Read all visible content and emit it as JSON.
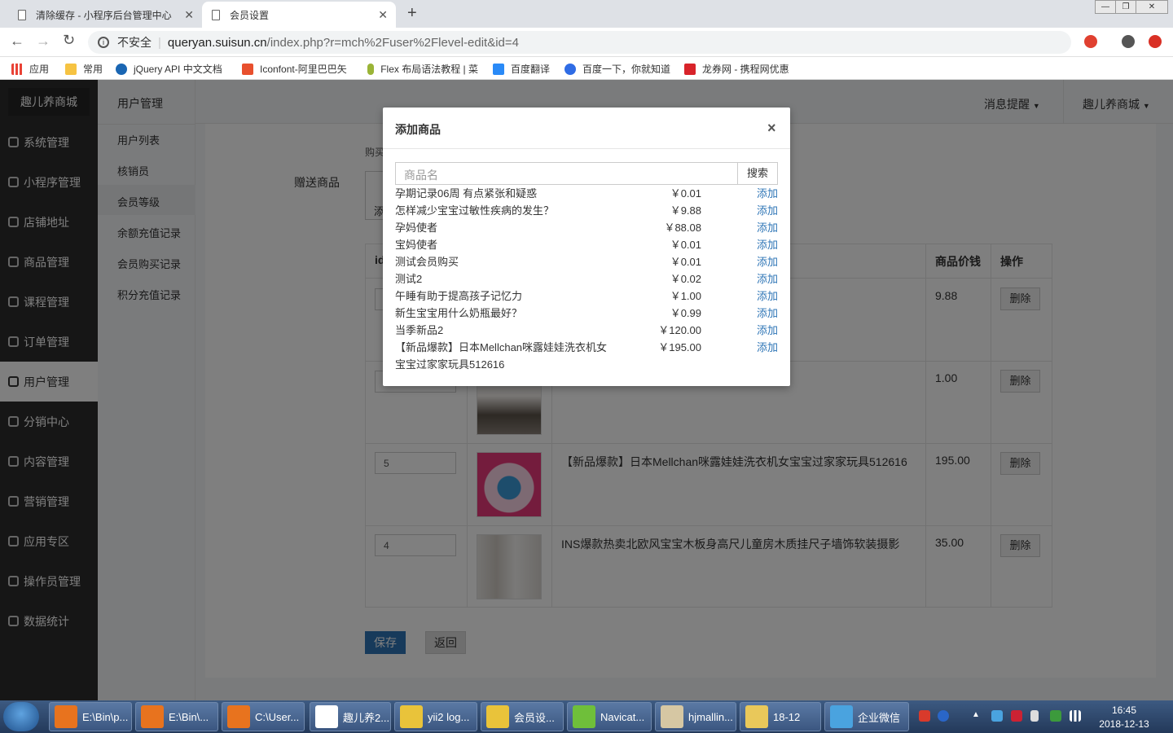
{
  "browser": {
    "tabs": [
      {
        "title": "清除缓存 - 小程序后台管理中心"
      },
      {
        "title": "会员设置"
      }
    ],
    "security_label": "不安全",
    "url_host": "queryan.suisun.cn",
    "url_path": "/index.php?r=mch%2Fuser%2Flevel-edit&id=4",
    "bookmarks": [
      "应用",
      "常用",
      "jQuery API 中文文档",
      "Iconfont-阿里巴巴矢",
      "Flex 布局语法教程 | 菜",
      "百度翻译",
      "百度一下，你就知道",
      "龙券网 - 携程网优惠"
    ]
  },
  "app": {
    "logo": "趣儿养商城",
    "section_title": "用户管理",
    "top_nav": {
      "messages": "消息提醒",
      "store": "趣儿养商城"
    },
    "sidebar": [
      {
        "label": "系统管理"
      },
      {
        "label": "小程序管理"
      },
      {
        "label": "店铺地址"
      },
      {
        "label": "商品管理"
      },
      {
        "label": "课程管理"
      },
      {
        "label": "订单管理"
      },
      {
        "label": "用户管理"
      },
      {
        "label": "分销中心"
      },
      {
        "label": "内容管理"
      },
      {
        "label": "营销管理"
      },
      {
        "label": "应用专区"
      },
      {
        "label": "操作员管理"
      },
      {
        "label": "数据统计"
      }
    ],
    "submenu": [
      "用户列表",
      "核销员",
      "会员等级",
      "余额充值记录",
      "会员购买记录",
      "积分充值记录"
    ],
    "form": {
      "gift_label": "赠送商品",
      "partial_label_1": "购买",
      "partial_label_2": "添",
      "table_headers": {
        "id": "id",
        "price": "商品价钱",
        "action": "操作"
      },
      "rows": [
        {
          "qty": "",
          "name": "",
          "price": "9.88",
          "action": "删除"
        },
        {
          "qty": "",
          "name": "",
          "price": "1.00",
          "action": "删除"
        },
        {
          "qty": "5",
          "name": "【新品爆款】日本Mellchan咪露娃娃洗衣机女宝宝过家家玩具512616",
          "price": "195.00",
          "action": "删除"
        },
        {
          "qty": "4",
          "name": "INS爆款热卖北欧风宝宝木板身高尺儿童房木质挂尺子墙饰软装摄影",
          "price": "35.00",
          "action": "删除"
        }
      ],
      "save": "保存",
      "back": "返回"
    }
  },
  "modal": {
    "title": "添加商品",
    "close": "×",
    "search_placeholder": "商品名",
    "search_button": "搜索",
    "items": [
      {
        "name": "孕期记录06周 有点紧张和疑惑",
        "price": "￥0.01",
        "action": "添加"
      },
      {
        "name": "怎样减少宝宝过敏性疾病的发生？",
        "price": "￥9.88",
        "action": "添加"
      },
      {
        "name": "孕妈使者",
        "price": "￥88.08",
        "action": "添加"
      },
      {
        "name": "宝妈使者",
        "price": "￥0.01",
        "action": "添加"
      },
      {
        "name": "测试会员购买",
        "price": "￥0.01",
        "action": "添加"
      },
      {
        "name": "测试2",
        "price": "￥0.02",
        "action": "添加"
      },
      {
        "name": "午睡有助于提高孩子记忆力",
        "price": "￥1.00",
        "action": "添加"
      },
      {
        "name": "新生宝宝用什么奶瓶最好？",
        "price": "￥0.99",
        "action": "添加"
      },
      {
        "name": "当季新品2",
        "price": "￥120.00",
        "action": "添加"
      },
      {
        "name": "【新品爆款】日本Mellchan咪露娃娃洗衣机女",
        "price": "￥195.00",
        "action": "添加"
      }
    ],
    "wrap_line": "宝宝过家家玩具512616"
  },
  "taskbar": {
    "buttons": [
      "E:\\Bin\\p...",
      "E:\\Bin\\...",
      "C:\\User...",
      "趣儿养2...",
      "yii2 log...",
      "会员设...",
      "Navicat...",
      "hjmallin...",
      "18-12",
      "企业微信"
    ],
    "time": "16:45",
    "date": "2018-12-13"
  },
  "colors": {
    "accent": "#2e75b6",
    "sidebar": "#2d2d2d",
    "taskbar": "#2c4670"
  }
}
